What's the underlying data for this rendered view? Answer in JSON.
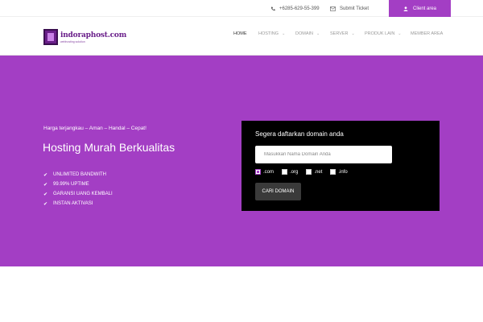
{
  "topbar": {
    "phone": "+6285-629-55-399",
    "ticket": "Submit Ticket",
    "client_area": "Client area"
  },
  "logo": {
    "name": "indoraphost.com",
    "tagline": "webhosting solution"
  },
  "nav": {
    "items": [
      {
        "label": "HOME",
        "active": true,
        "dropdown": false
      },
      {
        "label": "HOSTING",
        "active": false,
        "dropdown": true
      },
      {
        "label": "DOMAIN",
        "active": false,
        "dropdown": true
      },
      {
        "label": "SERVER",
        "active": false,
        "dropdown": true
      },
      {
        "label": "PRODUK LAIN",
        "active": false,
        "dropdown": true
      },
      {
        "label": "MEMBER AREA",
        "active": false,
        "dropdown": false
      }
    ]
  },
  "hero": {
    "tagline": "Harga terjangkau – Aman – Handal – Cepat!",
    "headline": "Hosting Murah Berkualitas",
    "features": [
      "UNLIMITED BANDWITH",
      "99.99% UPTIME",
      "GARANSI UANG KEMBALI",
      "INSTAN AKTIVASI"
    ]
  },
  "domain_search": {
    "title": "Segera daftarkan domain anda",
    "placeholder": "Masukkan Nama Domain Anda",
    "tlds": [
      {
        "label": ".com",
        "checked": true
      },
      {
        "label": ".org",
        "checked": false
      },
      {
        "label": ".net",
        "checked": false
      },
      {
        "label": ".info",
        "checked": false
      }
    ],
    "button": "CARI DOMAIN"
  },
  "colors": {
    "brand": "#a33ec4",
    "dark_panel": "#000000",
    "button": "#3a3a3a"
  },
  "icons": {
    "phone": "phone-icon",
    "ticket": "envelope-icon",
    "client": "user-icon",
    "feature": "check-icon"
  }
}
